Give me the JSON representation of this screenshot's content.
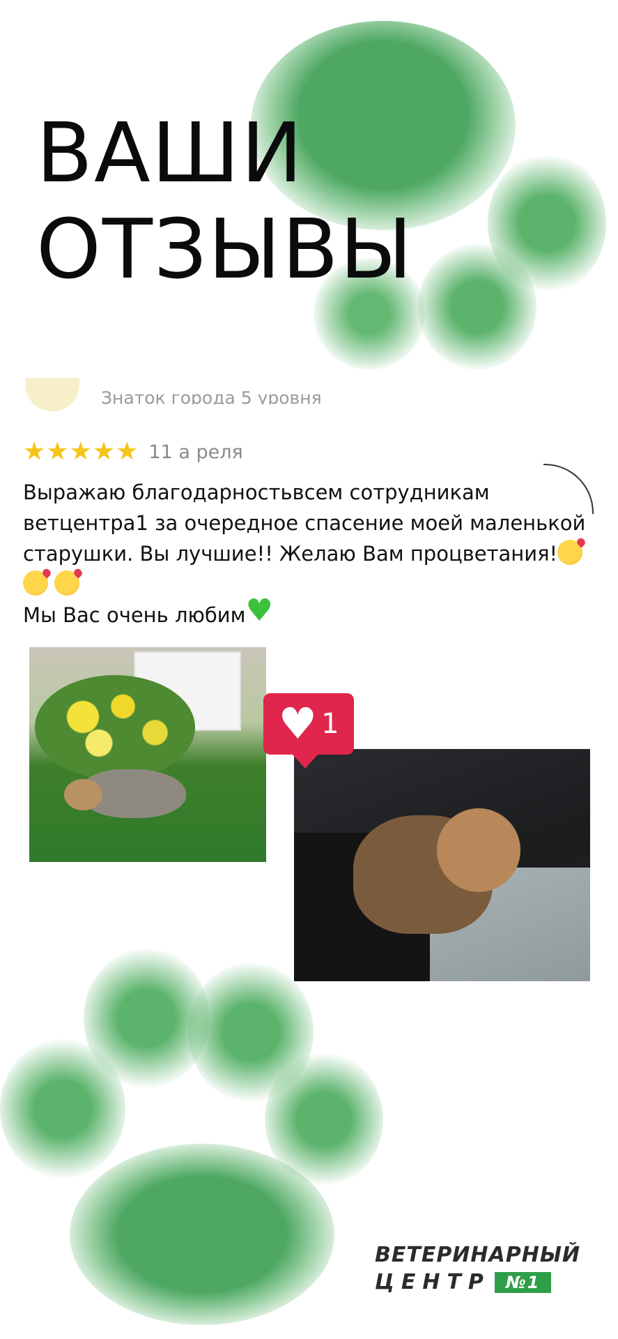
{
  "header": {
    "title_line1": "ВАШИ",
    "title_line2": "ОТЗЫВЫ"
  },
  "review": {
    "author_level": "Знаток города 5 уровня",
    "stars": 5,
    "date": "11 а   реля",
    "text_line1": "Выражаю благодарностьвсем сотрудникам",
    "text_line2": "ветцентра1 за очередное спасение моей маленькой",
    "text_line3": "старушки. Вы лучшие!! Желаю Вам процветания!",
    "text_line4": "Мы Вас очень любим"
  },
  "photos": [
    "dog-on-grass-photo",
    "dog-in-car-photo"
  ],
  "like_badge": {
    "count": "1",
    "icon": "heart-icon"
  },
  "brand": {
    "line1": "ВЕТЕРИНАРНЫЙ",
    "line2": "ЦЕНТР",
    "badge": "№1"
  },
  "colors": {
    "paw_green": "#5fb56e",
    "star": "#f5c518",
    "like": "#e0264d",
    "brand_green": "#2f9e4a"
  }
}
